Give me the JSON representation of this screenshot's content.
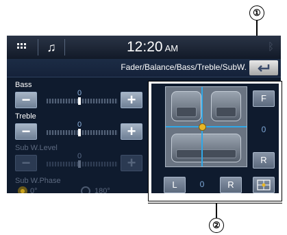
{
  "callouts": {
    "one": "①",
    "two": "②"
  },
  "topbar": {
    "time": "12:20",
    "ampm": "AM"
  },
  "title": "Fader/Balance/Bass/Treble/SubW.",
  "controls": {
    "bass": {
      "label": "Bass",
      "value": "0",
      "minus": "−",
      "plus": "+"
    },
    "treble": {
      "label": "Treble",
      "value": "0",
      "minus": "−",
      "plus": "+"
    },
    "subw_level": {
      "label": "Sub W.Level",
      "value": "0",
      "minus": "−",
      "plus": "+"
    },
    "subw_phase": {
      "label": "Sub W.Phase",
      "options": [
        "0°",
        "180°"
      ],
      "selected": "0°"
    }
  },
  "fader_balance": {
    "front_label": "F",
    "rear_label": "R",
    "fader_value": "0",
    "left_label": "L",
    "right_label": "R",
    "balance_value": "0"
  },
  "colors": {
    "crosshair": "#2fa8e8",
    "position_dot": "#e8b625",
    "value_text": "#7fa9d8"
  }
}
